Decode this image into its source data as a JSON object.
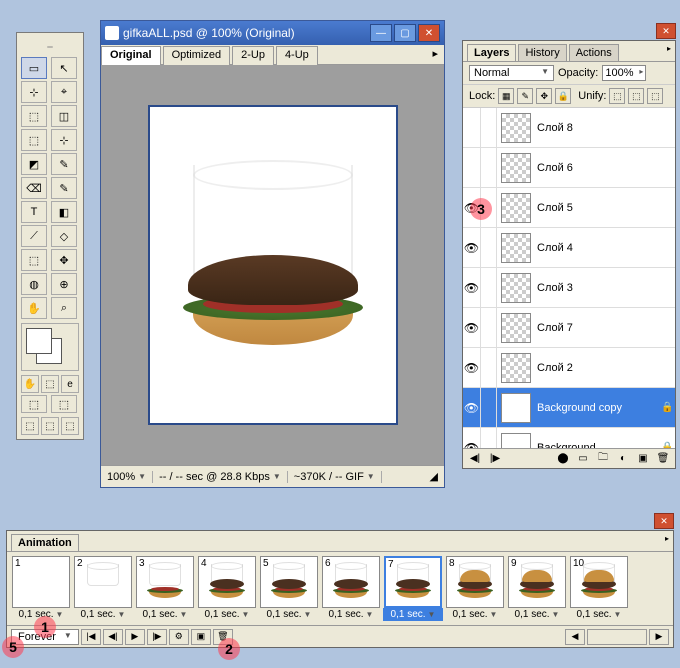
{
  "tools": {
    "icons": [
      "▭",
      "↖",
      "⊹",
      "⌖",
      "⬚",
      "◫",
      "⬚",
      "⊹",
      "◩",
      "✎",
      "⌫",
      "✎",
      "T",
      "◧",
      "⟋",
      "◇",
      "⬚",
      "✥",
      "◍",
      "⊕",
      "✋",
      "⌕"
    ],
    "bottom_icons": [
      "✋",
      "⬚",
      "e",
      "⬚",
      "⬚",
      "⬚",
      "⬚",
      "⬚"
    ]
  },
  "doc": {
    "title": "gifkaALL.psd @ 100% (Original)",
    "tabs": [
      "Original",
      "Optimized",
      "2-Up",
      "4-Up"
    ],
    "active_tab": 0,
    "status": {
      "zoom": "100%",
      "rate": "-- / -- sec @ 28.8 Kbps",
      "size": "~370K / -- GIF"
    }
  },
  "layers_panel": {
    "tabs": [
      "Layers",
      "History",
      "Actions"
    ],
    "active_tab": 0,
    "blend_mode": "Normal",
    "opacity_label": "Opacity:",
    "opacity_value": "100%",
    "lock_label": "Lock:",
    "unify_label": "Unify:",
    "layers": [
      {
        "name": "Слой 8",
        "visible": false,
        "checker": true
      },
      {
        "name": "Слой 6",
        "visible": false,
        "checker": true
      },
      {
        "name": "Слой 5",
        "visible": true,
        "checker": true
      },
      {
        "name": "Слой 4",
        "visible": true,
        "checker": true
      },
      {
        "name": "Слой 3",
        "visible": true,
        "checker": true
      },
      {
        "name": "Слой 7",
        "visible": true,
        "checker": true
      },
      {
        "name": "Слой 2",
        "visible": true,
        "checker": true
      },
      {
        "name": "Background copy",
        "visible": true,
        "checker": false,
        "selected": true,
        "locked": true
      },
      {
        "name": "Background",
        "visible": true,
        "checker": false,
        "locked": true
      }
    ]
  },
  "animation": {
    "tab": "Animation",
    "loop": "Forever",
    "frames": [
      {
        "num": 1,
        "delay": "0,1 sec.",
        "stage": 0
      },
      {
        "num": 2,
        "delay": "0,1 sec.",
        "stage": 1
      },
      {
        "num": 3,
        "delay": "0,1 sec.",
        "stage": 2
      },
      {
        "num": 4,
        "delay": "0,1 sec.",
        "stage": 3
      },
      {
        "num": 5,
        "delay": "0,1 sec.",
        "stage": 3
      },
      {
        "num": 6,
        "delay": "0,1 sec.",
        "stage": 3
      },
      {
        "num": 7,
        "delay": "0,1 sec.",
        "stage": 3,
        "selected": true
      },
      {
        "num": 8,
        "delay": "0,1 sec.",
        "stage": 4
      },
      {
        "num": 9,
        "delay": "0,1 sec.",
        "stage": 4
      },
      {
        "num": 10,
        "delay": "0,1 sec.",
        "stage": 4
      }
    ]
  },
  "markers": {
    "m1": "1",
    "m2": "2",
    "m3": "3",
    "m5": "5"
  }
}
